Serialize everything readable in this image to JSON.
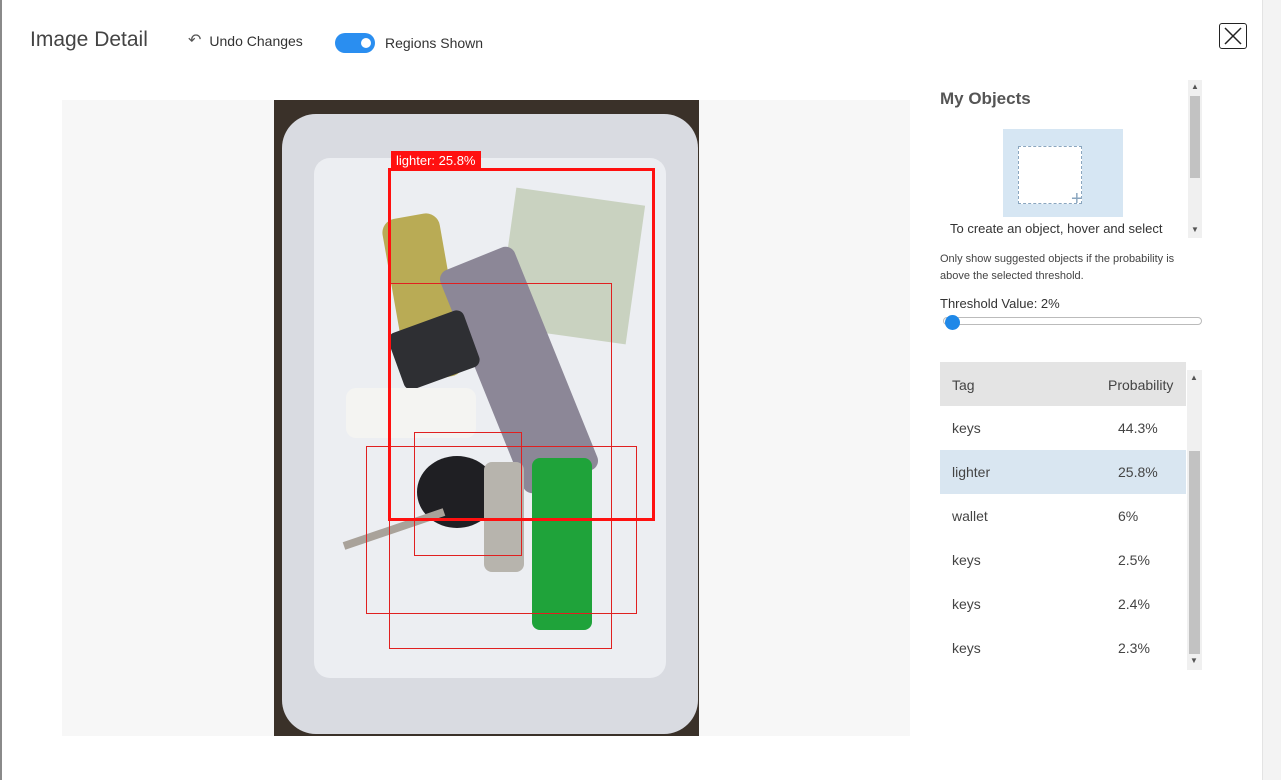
{
  "header": {
    "title": "Image Detail",
    "undo_label": "Undo Changes",
    "regions_toggle_label": "Regions Shown",
    "regions_shown": true
  },
  "image": {
    "selected_region_label": "lighter: 25.8%"
  },
  "objects_panel": {
    "title": "My Objects",
    "create_hint": "To create an object, hover and select"
  },
  "threshold": {
    "note": "Only show suggested objects if the probability is above the selected threshold.",
    "label": "Threshold Value: 2%",
    "value_percent": 2
  },
  "table": {
    "columns": [
      "Tag",
      "Probability"
    ],
    "rows": [
      {
        "tag": "keys",
        "probability": "44.3%"
      },
      {
        "tag": "lighter",
        "probability": "25.8%",
        "selected": true
      },
      {
        "tag": "wallet",
        "probability": "6%"
      },
      {
        "tag": "keys",
        "probability": "2.5%"
      },
      {
        "tag": "keys",
        "probability": "2.4%"
      },
      {
        "tag": "keys",
        "probability": "2.3%"
      }
    ]
  },
  "colors": {
    "accent": "#2a8ef0",
    "region": "#ff1010",
    "selected_row": "#d9e6f1"
  },
  "icons": {
    "undo": "undo-icon",
    "close": "close-icon",
    "add_region": "add-region-icon"
  }
}
